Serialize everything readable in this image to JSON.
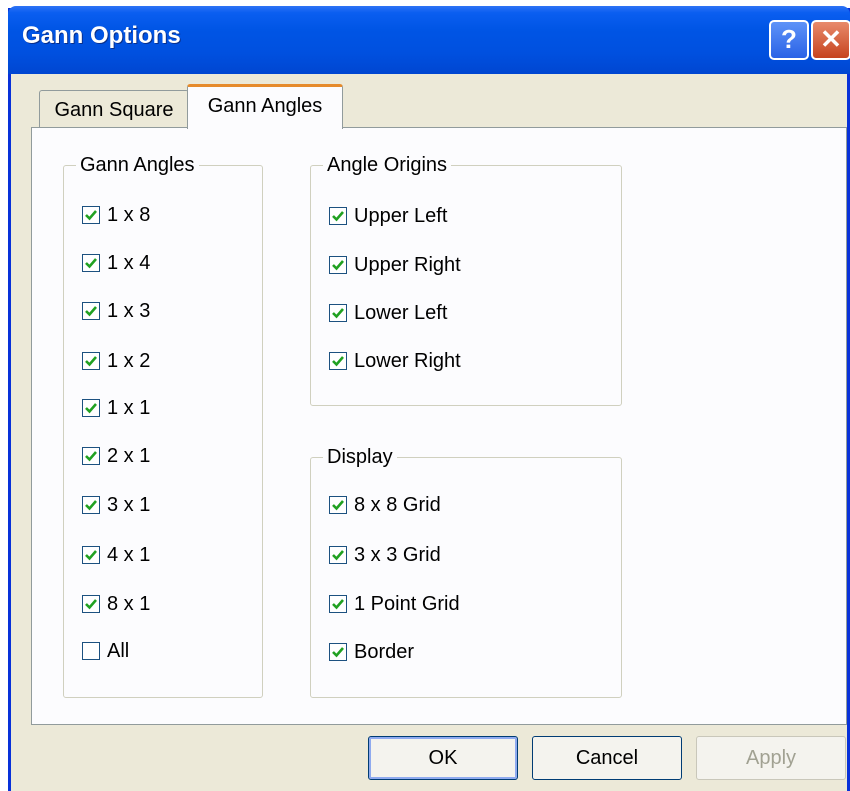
{
  "window": {
    "title": "Gann Options"
  },
  "title_buttons": {
    "help": "?",
    "close": "✕"
  },
  "tabs": [
    {
      "label": "Gann Square",
      "active": false
    },
    {
      "label": "Gann Angles",
      "active": true
    }
  ],
  "gann_angles": {
    "title": "Gann Angles",
    "items": [
      {
        "label": "1 x 8",
        "checked": true
      },
      {
        "label": "1 x 4",
        "checked": true
      },
      {
        "label": "1 x 3",
        "checked": true
      },
      {
        "label": "1 x 2",
        "checked": true
      },
      {
        "label": "1 x 1",
        "checked": true
      },
      {
        "label": "2 x 1",
        "checked": true
      },
      {
        "label": "3 x 1",
        "checked": true
      },
      {
        "label": "4 x 1",
        "checked": true
      },
      {
        "label": "8 x 1",
        "checked": true
      },
      {
        "label": "All",
        "checked": false
      }
    ]
  },
  "angle_origins": {
    "title": "Angle Origins",
    "items": [
      {
        "label": "Upper Left",
        "checked": true
      },
      {
        "label": "Upper Right",
        "checked": true
      },
      {
        "label": "Lower Left",
        "checked": true
      },
      {
        "label": "Lower Right",
        "checked": true
      }
    ]
  },
  "display": {
    "title": "Display",
    "items": [
      {
        "label": "8 x 8 Grid",
        "checked": true
      },
      {
        "label": "3 x 3 Grid",
        "checked": true
      },
      {
        "label": "1 Point Grid",
        "checked": true
      },
      {
        "label": "Border",
        "checked": true
      }
    ]
  },
  "buttons": {
    "ok": "OK",
    "cancel": "Cancel",
    "apply": "Apply",
    "apply_enabled": false
  },
  "colors": {
    "title_bar": "#0054e3",
    "dialog_bg": "#ece9d8",
    "active_tab_accent": "#e68b2c"
  }
}
